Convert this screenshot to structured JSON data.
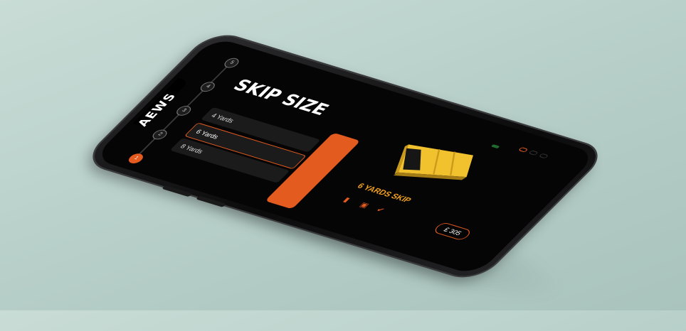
{
  "brand": {
    "logo_text": "AEWS"
  },
  "steps": [
    {
      "label": "1",
      "active": true
    },
    {
      "label": "2",
      "active": false
    },
    {
      "label": "3",
      "active": false
    },
    {
      "label": "4",
      "active": false
    },
    {
      "label": "5",
      "active": false
    }
  ],
  "page": {
    "title": "SKIP SIZE",
    "subtitle": ""
  },
  "options": [
    {
      "label": "4 Yards"
    },
    {
      "label": "6 Yards"
    },
    {
      "label": "8 Yards"
    }
  ],
  "cta_label": "",
  "product": {
    "name": "6 YARDS SKIP",
    "badge": "",
    "price": "£ 305"
  },
  "colors": {
    "accent": "#e35b1f",
    "skip_yellow": "#f2c12e",
    "background": "#050505"
  }
}
